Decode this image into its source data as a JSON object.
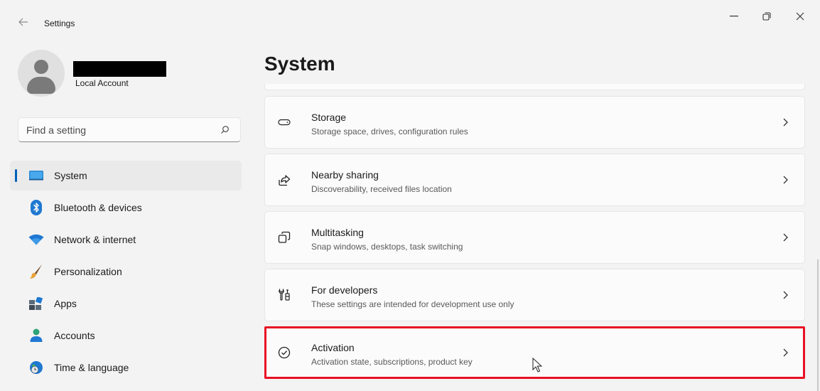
{
  "window": {
    "title": "Settings",
    "controls": [
      "minimize",
      "restore",
      "close"
    ]
  },
  "profile": {
    "account_type": "Local Account"
  },
  "search": {
    "placeholder": "Find a setting"
  },
  "nav": {
    "items": [
      {
        "label": "System",
        "icon": "system-monitor-icon",
        "active": true
      },
      {
        "label": "Bluetooth & devices",
        "icon": "bluetooth-icon"
      },
      {
        "label": "Network & internet",
        "icon": "wifi-icon"
      },
      {
        "label": "Personalization",
        "icon": "brush-icon"
      },
      {
        "label": "Apps",
        "icon": "apps-icon"
      },
      {
        "label": "Accounts",
        "icon": "person-icon"
      },
      {
        "label": "Time & language",
        "icon": "globe-clock-icon"
      }
    ]
  },
  "main": {
    "title": "System",
    "cards": [
      {
        "title": "Storage",
        "description": "Storage space, drives, configuration rules",
        "icon": "storage-drive-icon"
      },
      {
        "title": "Nearby sharing",
        "description": "Discoverability, received files location",
        "icon": "share-icon"
      },
      {
        "title": "Multitasking",
        "description": "Snap windows, desktops, task switching",
        "icon": "multitasking-icon"
      },
      {
        "title": "For developers",
        "description": "These settings are intended for development use only",
        "icon": "developer-tools-icon"
      },
      {
        "title": "Activation",
        "description": "Activation state, subscriptions, product key",
        "icon": "check-circle-icon",
        "highlighted": true
      }
    ]
  },
  "colors": {
    "accent": "#005fb8",
    "highlight_border": "#e81123",
    "background": "#f3f3f3",
    "card": "#fbfbfb"
  }
}
